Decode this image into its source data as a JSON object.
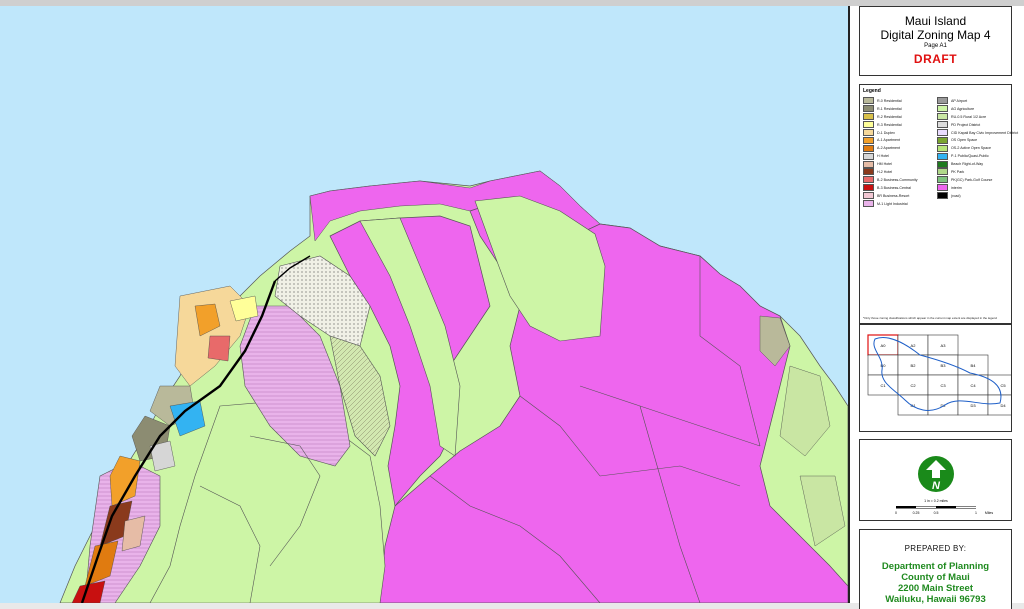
{
  "title_block": {
    "line1": "Maui Island",
    "line2": "Digital Zoning Map 4",
    "page": "Page A1",
    "status": "DRAFT"
  },
  "legend": {
    "title": "Legend",
    "left_items": [
      {
        "label": "R-0 Residential",
        "color": "#b9b99a"
      },
      {
        "label": "R-1 Residential",
        "color": "#8c8c72"
      },
      {
        "label": "R-2 Residential",
        "color": "#d8c04a"
      },
      {
        "label": "R-3 Residential",
        "color": "#ffff99"
      },
      {
        "label": "D-1 Duplex",
        "color": "#f6d89a"
      },
      {
        "label": "A-1 Apartment",
        "color": "#f2a02a"
      },
      {
        "label": "A-2 Apartment",
        "color": "#e07b10"
      },
      {
        "label": "H Hotel",
        "color": "#d6d6d6"
      },
      {
        "label": "HM Hotel",
        "color": "#e6bca6"
      },
      {
        "label": "H-2 Hotel",
        "color": "#8a3a1c"
      },
      {
        "label": "B-2 Business-Community",
        "color": "#e86a6a"
      },
      {
        "label": "B-3 Business-Central",
        "color": "#c81010"
      },
      {
        "label": "BR Business-Resort",
        "color": "#f2c8d4"
      },
      {
        "label": "M-1 Light Industrial",
        "color": "#e9b3ea"
      }
    ],
    "right_items": [
      {
        "label": "AP Airport",
        "color": "#9a9a9a"
      },
      {
        "label": "AG Agriculture",
        "color": "#cdf5a6"
      },
      {
        "label": "RU-0.5 Rural 1/2 Acre",
        "color": "#c9e6a3"
      },
      {
        "label": "PD Project District",
        "color": "#dddddd"
      },
      {
        "label": "CID Kapali Bay Civic Improvement District",
        "color": "#eadcff"
      },
      {
        "label": "OS Open Space",
        "color": "#7aa530"
      },
      {
        "label": "OS-2 Active Open Space",
        "color": "#b7e67a"
      },
      {
        "label": "P-1 Public/Quasi-Public",
        "color": "#33b3f2"
      },
      {
        "label": "Beach Right-of-Way",
        "color": "#1f7a1f"
      },
      {
        "label": "PK Park",
        "color": "#b0d88a"
      },
      {
        "label": "PK(GC) Park-Golf Course",
        "color": "#7fc37f"
      },
      {
        "label": "interim",
        "color": "#ee66ee"
      },
      {
        "label": "(road)",
        "color": "#000000"
      }
    ],
    "note": "*Only those zoning classifications which appear in the current map extent are displayed in the legend"
  },
  "index_map": {
    "cells": [
      "A0",
      "A2",
      "A3",
      "B0",
      "B2",
      "B3",
      "B4",
      "C1",
      "C2",
      "C3",
      "C4",
      "C5",
      "D1",
      "D2",
      "D3",
      "D4"
    ]
  },
  "scale_bar": {
    "caption": "1 in = 0.2 miles",
    "ticks": [
      "0",
      "0.25",
      "0.5",
      "1",
      "Miles"
    ]
  },
  "prepared_by": {
    "label": "PREPARED BY:",
    "line1": "Department of Planning",
    "line2": "County of Maui",
    "line3": "2200 Main Street",
    "line4": "Wailuku, Hawaii  96793"
  },
  "colors": {
    "ocean": "#bfe7fb",
    "agriculture": "#cdf5a6",
    "interim": "#ee66ee",
    "rural": "#c9e6a3",
    "light_industrial": "#e9b3ea",
    "road": "#000000",
    "outline": "#6a6a6a",
    "draft": "#e01010",
    "prepared_green": "#1f8a1f"
  }
}
